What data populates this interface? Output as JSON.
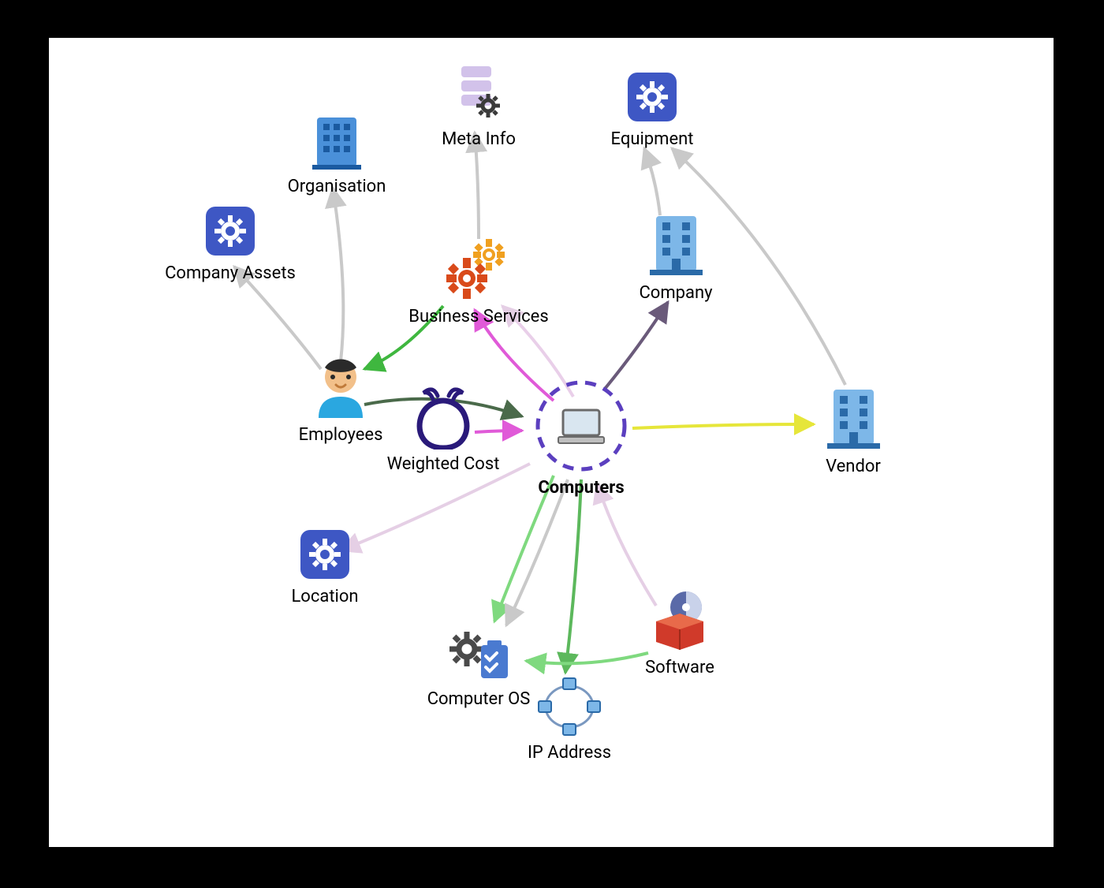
{
  "diagram": {
    "nodes": {
      "computers": {
        "label": "Computers",
        "icon": "laptop-icon"
      },
      "weighted_cost": {
        "label": "Weighted Cost",
        "icon": "weighted-cost-icon"
      },
      "employees": {
        "label": "Employees",
        "icon": "person-icon"
      },
      "company_assets": {
        "label": "Company Assets",
        "icon": "gear-box-icon"
      },
      "organisation": {
        "label": "Organisation",
        "icon": "building-blue-icon"
      },
      "meta_info": {
        "label": "Meta Info",
        "icon": "server-gear-icon"
      },
      "business_services": {
        "label": "Business Services",
        "icon": "gears-orange-icon"
      },
      "equipment": {
        "label": "Equipment",
        "icon": "gear-box-icon"
      },
      "company": {
        "label": "Company",
        "icon": "building-light-icon"
      },
      "vendor": {
        "label": "Vendor",
        "icon": "building-light-icon"
      },
      "location": {
        "label": "Location",
        "icon": "gear-box-icon"
      },
      "computer_os": {
        "label": "Computer OS",
        "icon": "gear-checklist-icon"
      },
      "ip_address": {
        "label": "IP Address",
        "icon": "network-icon"
      },
      "software": {
        "label": "Software",
        "icon": "software-disc-icon"
      }
    },
    "edges": [
      {
        "from": "employees",
        "to": "company_assets",
        "color": "#c9c9c9"
      },
      {
        "from": "employees",
        "to": "organisation",
        "color": "#c9c9c9"
      },
      {
        "from": "business_services",
        "to": "meta_info",
        "color": "#c9c9c9"
      },
      {
        "from": "company",
        "to": "equipment",
        "color": "#c9c9c9"
      },
      {
        "from": "vendor",
        "to": "equipment",
        "color": "#c9c9c9"
      },
      {
        "from": "business_services",
        "to": "employees",
        "color": "#3fb73f"
      },
      {
        "from": "computers",
        "to": "business_services",
        "color": "#e05ad8"
      },
      {
        "from": "computers",
        "to": "business_services",
        "color": "#e9cfe9"
      },
      {
        "from": "employees",
        "to": "computers",
        "color": "#4a6a4a"
      },
      {
        "from": "weighted_cost",
        "to": "computers",
        "color": "#e05ad8"
      },
      {
        "from": "computers",
        "to": "company",
        "color": "#6a5a7a"
      },
      {
        "from": "computers",
        "to": "vendor",
        "color": "#e6e63a"
      },
      {
        "from": "computers",
        "to": "location",
        "color": "#e5cfe5"
      },
      {
        "from": "computers",
        "to": "computer_os",
        "color": "#7fd97f"
      },
      {
        "from": "computers",
        "to": "computer_os",
        "color": "#c9c9c9"
      },
      {
        "from": "computers",
        "to": "ip_address",
        "color": "#5cb85c"
      },
      {
        "from": "software",
        "to": "computers",
        "color": "#e5cfe5"
      },
      {
        "from": "software",
        "to": "computer_os",
        "color": "#7fd97f"
      }
    ],
    "colors": {
      "frame_bg": "#ffffff",
      "page_bg": "#000000",
      "dash_ring": "#5b3fbf",
      "gear_box": "#3e57c4",
      "building_light": "#7db7e8",
      "building_blue": "#4a90d9"
    }
  }
}
